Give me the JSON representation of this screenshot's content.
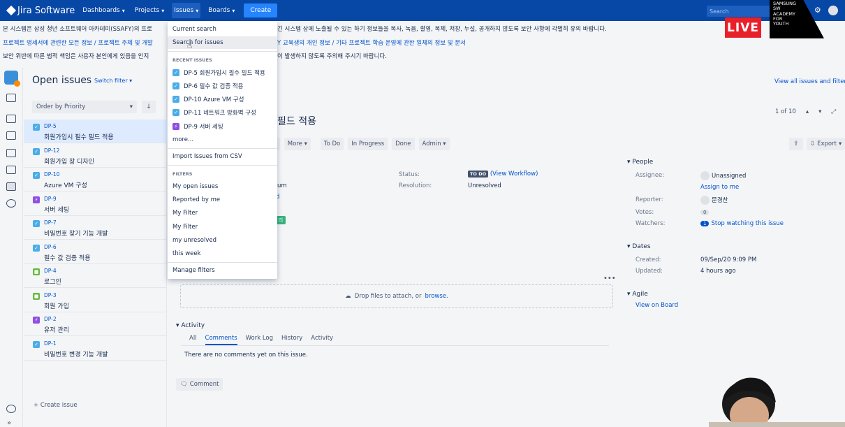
{
  "nav": {
    "logo": "Jira Software",
    "items": [
      "Dashboards",
      "Projects",
      "Issues",
      "Boards"
    ],
    "create": "Create",
    "search_placeholder": "Search"
  },
  "banner": {
    "line1a": "본 시스템은 삼성 청년 소프트웨어 아카데미(SSAFY)의 프로",
    "line1b": "긴 시스템 상에 노출될 수 있는 하기 정보들을 복사, 녹음, 촬영, 복제, 저장, 누설, 공개하지 않도록 보안 사항에 각별히 유의 바랍니다.",
    "line2a": "프로젝트 명세서에 관련한 모든 정보 / 프로젝트 주제 및 개발",
    "line2b": "Y 교육생의 개인 정보 / 기타 프로젝트 학습 운영에 관한 일체의 정보 및 문서",
    "line3a": "보안 위반에 따른 법적 책임은 사용자 본인에게 있음을 인지",
    "line3b": "이 발생하지 않도록 주의해 주시기 바랍니다."
  },
  "overlay": {
    "live": "LIVE",
    "academy": [
      "SAMSUNG",
      "SW",
      "ACADEMY",
      "FOR",
      "YOUTH"
    ]
  },
  "list": {
    "title": "Open issues",
    "switch": "Switch filter",
    "order": "Order by Priority",
    "create_issue": "+ Create issue",
    "issues": [
      {
        "key": "DP-5",
        "summary": "회원가입시 필수 필드 적용",
        "type": "task"
      },
      {
        "key": "DP-12",
        "summary": "회원가입 창 디자인",
        "type": "task"
      },
      {
        "key": "DP-10",
        "summary": "Azure VM 구성",
        "type": "task"
      },
      {
        "key": "DP-9",
        "summary": "서버 세팅",
        "type": "epic"
      },
      {
        "key": "DP-7",
        "summary": "비밀번호 찾기 기능 개발",
        "type": "task"
      },
      {
        "key": "DP-6",
        "summary": "필수 값 검증 적용",
        "type": "task"
      },
      {
        "key": "DP-4",
        "summary": "로그인",
        "type": "story"
      },
      {
        "key": "DP-3",
        "summary": "회원 가입",
        "type": "story"
      },
      {
        "key": "DP-2",
        "summary": "유저 관리",
        "type": "epic"
      },
      {
        "key": "DP-1",
        "summary": "비밀번호 변경 기능 개발",
        "type": "task"
      }
    ]
  },
  "detail": {
    "view_all": "View all issues and filters",
    "pager": "1 of 10",
    "title": "필드 적용",
    "buttons": [
      "gn",
      "More",
      "To Do",
      "In Progress",
      "Done",
      "Admin"
    ],
    "export": "Export",
    "status_label": "Status:",
    "status_value": "TO DO",
    "view_workflow": "(View Workflow)",
    "resolution_label": "Resolution:",
    "resolution_value": "Unresolved",
    "priority_frag": "um",
    "label_frag": "리",
    "drop_text": "Drop files to attach, or ",
    "browse": "browse.",
    "activity": "Activity",
    "tabs": [
      "All",
      "Comments",
      "Work Log",
      "History",
      "Activity"
    ],
    "no_comments": "There are no comments yet on this issue.",
    "comment_btn": "Comment"
  },
  "people": {
    "heading": "People",
    "assignee_label": "Assignee:",
    "assignee": "Unassigned",
    "assign_me": "Assign to me",
    "reporter_label": "Reporter:",
    "reporter": "문경찬",
    "votes_label": "Votes:",
    "votes": "0",
    "watchers_label": "Watchers:",
    "watchers_count": "1",
    "watch_link": "Stop watching this issue"
  },
  "dates": {
    "heading": "Dates",
    "created_label": "Created:",
    "created": "09/Sep/20 9:09 PM",
    "updated_label": "Updated:",
    "updated": "4 hours ago"
  },
  "agile": {
    "heading": "Agile",
    "board": "View on Board"
  },
  "dropdown": {
    "current": "Current search",
    "search": "Search for issues",
    "recent_head": "RECENT ISSUES",
    "recent": [
      {
        "text": "DP-5 회원가입시 필수 필드 적용",
        "type": "task"
      },
      {
        "text": "DP-6 필수 값 검증 적용",
        "type": "task"
      },
      {
        "text": "DP-10 Azure VM 구성",
        "type": "task"
      },
      {
        "text": "DP-11 네트워크 방화벽 구성",
        "type": "task"
      },
      {
        "text": "DP-9 서버 세팅",
        "type": "epic"
      }
    ],
    "more": "more...",
    "import": "Import Issues from CSV",
    "filters_head": "FILTERS",
    "filters": [
      "My open issues",
      "Reported by me",
      "My Filter",
      "My Filter",
      "my unresolved",
      "this week"
    ],
    "manage": "Manage filters"
  }
}
